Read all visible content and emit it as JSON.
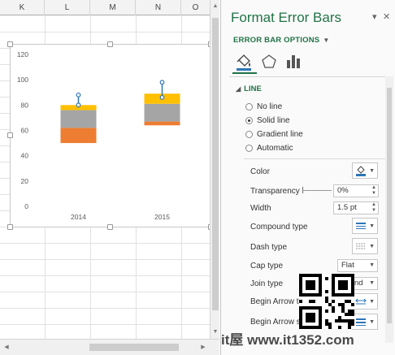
{
  "sheet": {
    "columns": [
      "K",
      "L",
      "M",
      "N",
      "O"
    ]
  },
  "chart_data": {
    "type": "bar",
    "stacked": true,
    "categories": [
      "2014",
      "2015"
    ],
    "series": [
      {
        "color": "#ffffff",
        "values": [
          50,
          64
        ]
      },
      {
        "color": "#ed7d31",
        "values": [
          12,
          3
        ]
      },
      {
        "color": "#a5a5a5",
        "values": [
          14,
          14
        ]
      },
      {
        "color": "#ffc000",
        "values": [
          4,
          8
        ]
      }
    ],
    "error_bars": {
      "color": "#2e75b6",
      "values": [
        [
          80,
          88
        ],
        [
          86,
          98
        ]
      ]
    },
    "ylim": [
      0,
      120
    ],
    "yticks": [
      0,
      20,
      40,
      60,
      80,
      100,
      120
    ],
    "grid": false
  },
  "pane": {
    "title": "Format Error Bars",
    "options_header": "ERROR BAR OPTIONS",
    "tabs": [
      {
        "icon": "fill-line-icon"
      },
      {
        "icon": "effects-pentagon-icon"
      },
      {
        "icon": "bar-chart-icon"
      }
    ],
    "section_title": "LINE",
    "line_options": [
      "No line",
      "Solid line",
      "Gradient line",
      "Automatic"
    ],
    "selected_line_option": "Solid line",
    "color_label": "Color",
    "color_value": "#2e75b6",
    "transparency_label": "Transparency",
    "transparency_value": "0%",
    "width_label": "Width",
    "width_value": "1.5 pt",
    "compound_label": "Compound type",
    "dash_label": "Dash type",
    "cap_label": "Cap type",
    "cap_value": "Flat",
    "join_label": "Join type",
    "join_value": "nd",
    "begin_arrow_type_label": "Begin Arrow t",
    "begin_arrow_size_label": "Begin Arrow s"
  },
  "watermark": "it屋 www.it1352.com"
}
